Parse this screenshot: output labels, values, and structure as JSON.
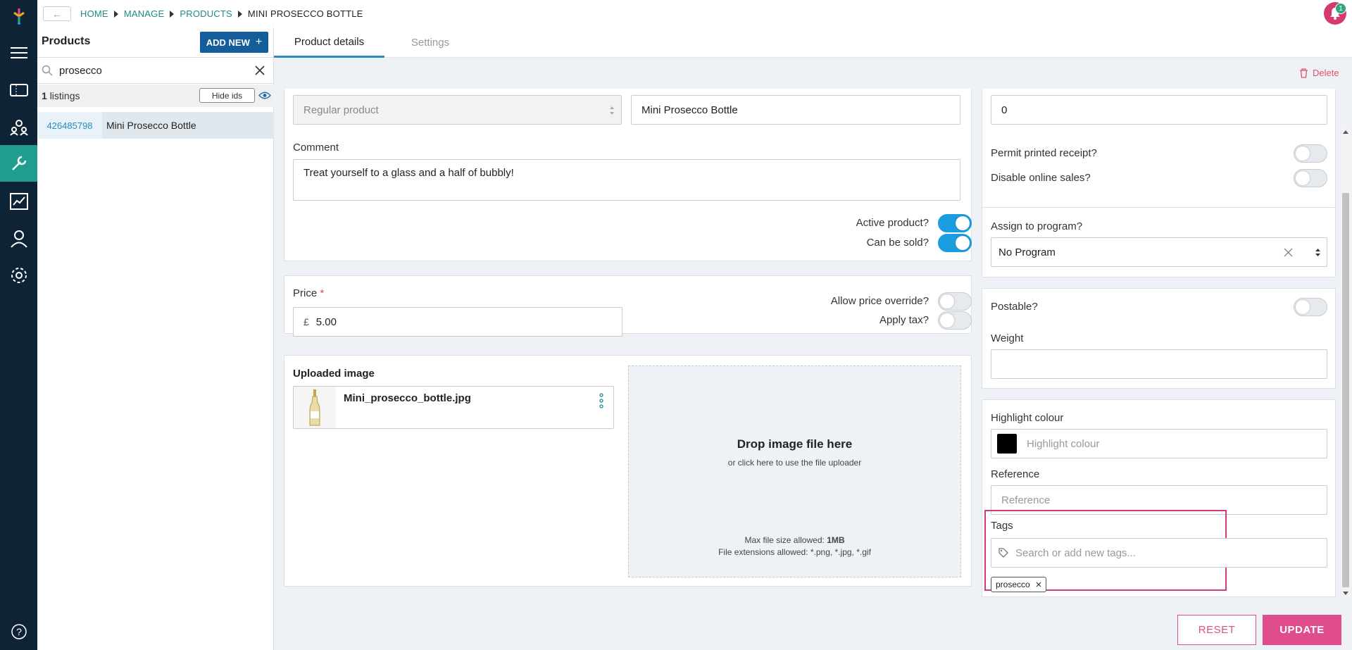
{
  "nav": {
    "items": [
      "menu-icon",
      "tickets-icon",
      "users-group-icon",
      "wrench-icon",
      "chart-icon",
      "person-icon",
      "gear-icon",
      "help-icon"
    ],
    "active": "wrench-icon",
    "brand_colors": [
      "#e04d8c",
      "#f2a61c",
      "#2ea77e",
      "#1a9ee0"
    ]
  },
  "header": {
    "back": "←",
    "breadcrumb": [
      "HOME",
      "MANAGE",
      "PRODUCTS",
      "MINI PROSECCO BOTTLE"
    ],
    "notification_count": "1"
  },
  "sidebar": {
    "title": "Products",
    "add_new": "ADD NEW",
    "search_value": "prosecco",
    "listing_count": "1",
    "listing_label": "listings",
    "hide_ids": "Hide ids",
    "results": [
      {
        "id": "426485798",
        "name": "Mini Prosecco Bottle"
      }
    ]
  },
  "tabs": [
    "Product details",
    "Settings"
  ],
  "toolbar": {
    "delete": "Delete"
  },
  "product": {
    "type_value": "Regular product",
    "name_value": "Mini Prosecco Bottle",
    "comment_label": "Comment",
    "comment_value": "Treat yourself to a glass and a half of bubbly!",
    "active_label": "Active product?",
    "active": true,
    "sold_label": "Can be sold?",
    "sold": true,
    "price_label": "Price",
    "price_required": "*",
    "currency": "£",
    "price_value": "5.00",
    "override_label": "Allow price override?",
    "override": false,
    "tax_label": "Apply tax?",
    "tax": false
  },
  "image": {
    "uploaded_label": "Uploaded image",
    "file_name": "Mini_prosecco_bottle.jpg",
    "drop_title": "Drop image file here",
    "drop_sub": "or click here to use the file uploader",
    "max_size_label": "Max file size allowed:",
    "max_size": "1MB",
    "extensions_label": "File extensions allowed:",
    "extensions": "*.png, *.jpg, *.gif"
  },
  "right": {
    "quantity_value": "0",
    "receipt_label": "Permit printed receipt?",
    "receipt": false,
    "online_label": "Disable online sales?",
    "online": false,
    "program_label": "Assign to program?",
    "program_value": "No Program",
    "postable_label": "Postable?",
    "postable": false,
    "weight_label": "Weight",
    "weight_value": "",
    "highlight_label": "Highlight colour",
    "highlight_placeholder": "Highlight colour",
    "highlight_color": "#000000",
    "reference_label": "Reference",
    "reference_placeholder": "Reference",
    "tags_label": "Tags",
    "tags_placeholder": "Search or add new tags...",
    "tags": [
      "prosecco"
    ],
    "highlight_box_color": "#d13a7f"
  },
  "footer": {
    "reset": "RESET",
    "update": "UPDATE"
  }
}
